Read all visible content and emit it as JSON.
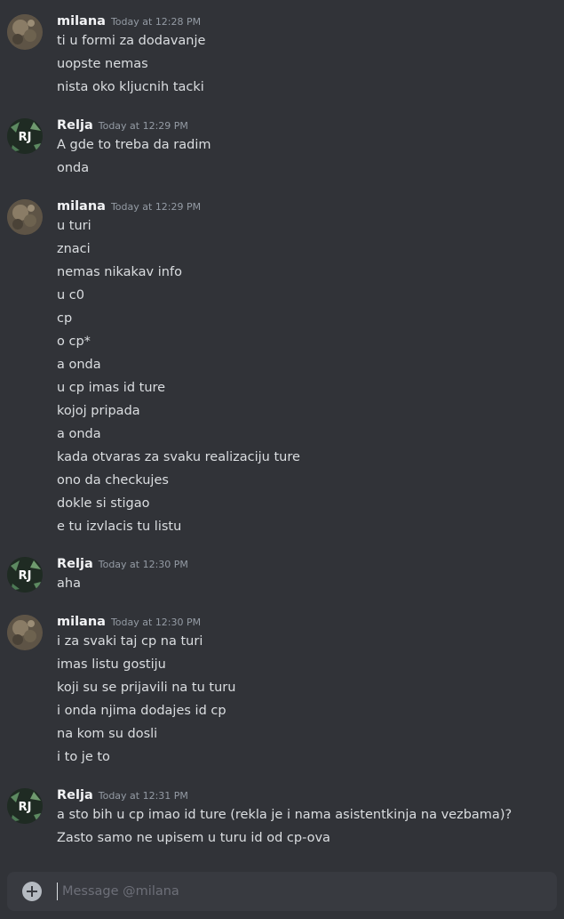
{
  "messages": [
    {
      "user": "milana",
      "timestamp": "Today at 12:28 PM",
      "avatar": "milana-avatar",
      "lines": [
        "ti u formi za dodavanje",
        "uopste nemas",
        "nista oko kljucnih tacki"
      ]
    },
    {
      "user": "Relja",
      "timestamp": "Today at 12:29 PM",
      "avatar": "rj-avatar",
      "avatar_text": "RJ",
      "lines": [
        "A gde to treba da radim",
        "onda"
      ]
    },
    {
      "user": "milana",
      "timestamp": "Today at 12:29 PM",
      "avatar": "milana-avatar",
      "lines": [
        "u turi",
        "znaci",
        "nemas nikakav info",
        "u c0",
        "cp",
        "o cp*",
        "a onda",
        "u cp imas id ture",
        "kojoj pripada",
        "a onda",
        "kada otvaras za svaku realizaciju ture",
        "ono da checkujes",
        "dokle si stigao",
        "e tu izvlacis tu listu"
      ]
    },
    {
      "user": "Relja",
      "timestamp": "Today at 12:30 PM",
      "avatar": "rj-avatar",
      "avatar_text": "RJ",
      "lines": [
        "aha"
      ]
    },
    {
      "user": "milana",
      "timestamp": "Today at 12:30 PM",
      "avatar": "milana-avatar",
      "lines": [
        "i za svaki taj cp na turi",
        "imas listu gostiju",
        "koji su se prijavili na tu turu",
        "i onda njima dodajes id cp",
        "na kom su dosli",
        "i to je to"
      ]
    },
    {
      "user": "Relja",
      "timestamp": "Today at 12:31 PM",
      "avatar": "rj-avatar",
      "avatar_text": "RJ",
      "lines": [
        "a sto bih u cp imao id ture (rekla je i nama asistentkinja na vezbama)?",
        "Zasto samo ne upisem u turu id od cp-ova"
      ]
    }
  ],
  "composer": {
    "placeholder": "Message @milana",
    "icon": "plus-circle-icon"
  }
}
